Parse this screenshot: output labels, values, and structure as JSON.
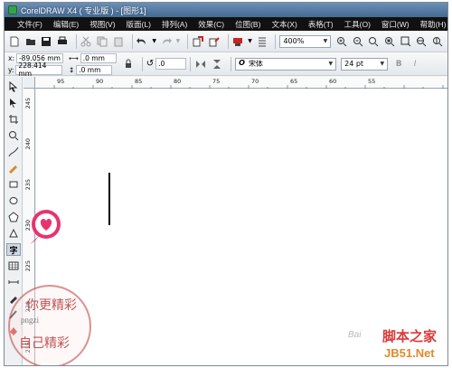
{
  "window": {
    "title": "CorelDRAW X4 ( 专业版 ) - [图形1]"
  },
  "menu": [
    "文件(F)",
    "编辑(E)",
    "视图(V)",
    "版面(L)",
    "排列(A)",
    "效果(C)",
    "位图(B)",
    "文本(X)",
    "表格(T)",
    "工具(O)",
    "窗口(W)",
    "帮助(H)"
  ],
  "toolbar": {
    "zoom": "400%",
    "icons": [
      "new-icon",
      "open-icon",
      "save-icon",
      "print-icon",
      "cut-icon",
      "copy-icon",
      "paste-icon",
      "undo-icon",
      "redo-icon",
      "import-icon",
      "export-icon",
      "application-launcher-icon",
      "welcome-icon"
    ]
  },
  "property_bar": {
    "x_label": "x:",
    "x_value": "-89.056 mm",
    "y_label": "y:",
    "y_value": "228.414 mm",
    "w_value": ".0 mm",
    "h_value": ".0 mm",
    "rotation": ".0",
    "font_name": "宋体",
    "font_size": "24 pt",
    "font_glyph": "O"
  },
  "ruler": {
    "h_ticks": [
      "95",
      "90",
      "85",
      "80",
      "75",
      "70",
      "65",
      "60",
      "55"
    ],
    "v_ticks": [
      "245",
      "240",
      "235",
      "230",
      "225",
      "220",
      "215"
    ]
  },
  "toolbox": {
    "text_tool_label": "字"
  },
  "watermarks": {
    "stamp_line1": "你更精彩",
    "stamp_line2": "pngzi",
    "stamp_line3": "自己精彩",
    "site_name": "脚本之家",
    "site_url": "JB51.Net",
    "baidu": "Bai"
  },
  "colors": {
    "menubar": "#111111",
    "title_gradient": "#5a7ea6",
    "accent_pink": "#e8336d"
  }
}
